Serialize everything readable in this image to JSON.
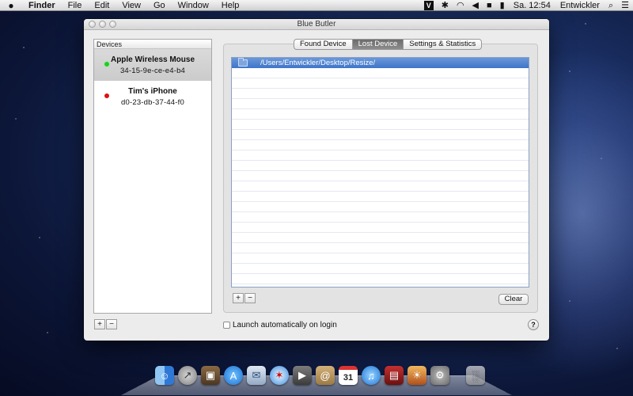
{
  "menubar": {
    "apple_icon": "",
    "items": [
      "Finder",
      "File",
      "Edit",
      "View",
      "Go",
      "Window",
      "Help"
    ],
    "status": {
      "time": "Sa. 12:54",
      "user": "Entwickler"
    },
    "icons": [
      "blue-butler-icon",
      "bluetooth-icon",
      "wifi-icon",
      "volume-icon",
      "flag-icon",
      "battery-icon"
    ]
  },
  "window": {
    "title": "Blue Butler",
    "devices": {
      "header": "Devices",
      "items": [
        {
          "name": "Apple Wireless Mouse",
          "mac": "34-15-9e-ce-e4-b4",
          "status_color": "#22cc22"
        },
        {
          "name": "Tim's iPhone",
          "mac": "d0-23-db-37-44-f0",
          "status_color": "#dd1111"
        }
      ],
      "add": "+",
      "remove": "−"
    },
    "tabs": [
      "Found Device",
      "Lost Device",
      "Settings & Statistics"
    ],
    "active_tab": "Lost Device",
    "lost_device": {
      "paths": [
        "/Users/Entwickler/Desktop/Resize/"
      ],
      "add": "+",
      "remove": "−",
      "clear": "Clear"
    },
    "launch_label": "Launch automatically on login",
    "help": "?"
  },
  "dock": {
    "icons": [
      "finder-icon",
      "launchpad-icon",
      "photo-booth-icon",
      "app-store-icon",
      "mail-icon",
      "safari-icon",
      "facetime-icon",
      "contacts-icon",
      "calendar-icon",
      "itunes-icon",
      "photo-booth-film-icon",
      "iphoto-icon",
      "system-preferences-icon",
      "trash-icon"
    ],
    "calendar_day": "31"
  },
  "colors": {
    "selection": "#3e74c9",
    "active_tab": "#7a7a7a",
    "online": "#22cc22",
    "offline": "#dd1111"
  }
}
